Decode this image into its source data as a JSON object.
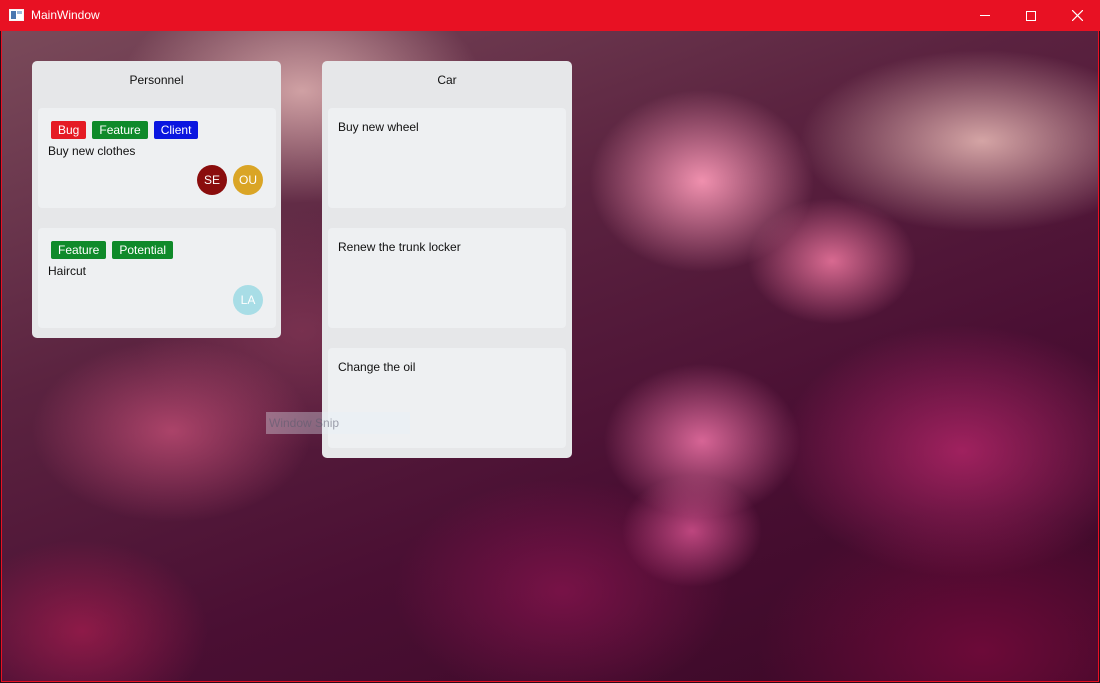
{
  "window": {
    "title": "MainWindow",
    "accent_color": "#e81123"
  },
  "board": {
    "columns": [
      {
        "title": "Personnel",
        "cards": [
          {
            "text": "Buy new clothes",
            "tags": [
              {
                "label": "Bug",
                "color": "#e51b24"
              },
              {
                "label": "Feature",
                "color": "#0f8a2a"
              },
              {
                "label": "Client",
                "color": "#0a16e0"
              }
            ],
            "avatars": [
              {
                "initials": "SE",
                "color": "#8a0d0d"
              },
              {
                "initials": "OU",
                "color": "#daa526"
              }
            ]
          },
          {
            "text": "Haircut",
            "tags": [
              {
                "label": "Feature",
                "color": "#0f8a2a"
              },
              {
                "label": "Potential",
                "color": "#0f8a2a"
              }
            ],
            "avatars": [
              {
                "initials": "LA",
                "color": "#a8dde6"
              }
            ]
          }
        ]
      },
      {
        "title": "Car",
        "cards": [
          {
            "text": "Buy new wheel"
          },
          {
            "text": "Renew the trunk locker"
          },
          {
            "text": "Change the oil"
          }
        ]
      }
    ]
  },
  "overlay": {
    "snip_label": "Window Snip"
  }
}
